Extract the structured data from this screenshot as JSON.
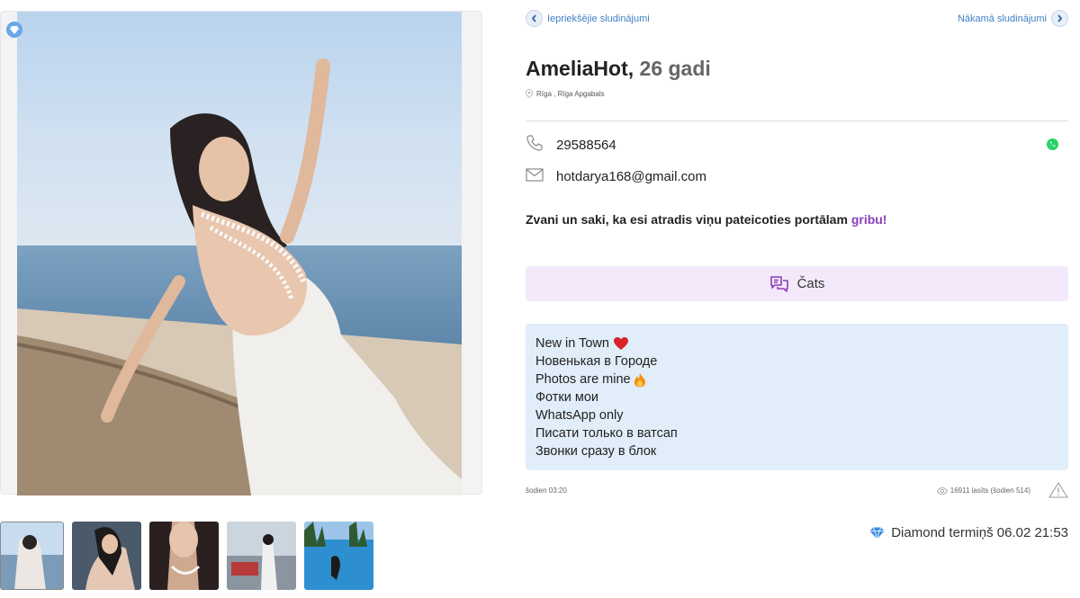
{
  "navigation": {
    "prev_label": "Iepriekšējie sludinājumi",
    "next_label": "Nākamā sludinājumi"
  },
  "listing": {
    "name": "AmeliaHot,",
    "age": "26 gadi",
    "location": "Rīga , Rīga Apgabals",
    "phone": "29588564",
    "email": "hotdarya168@gmail.com",
    "callout_text": "Zvani un saki, ka esi atradis viņu pateicoties portālam",
    "callout_brand": "gribu!",
    "chat_label": "Čats",
    "description_lines": [
      "New in Town",
      "Новенькая в Городе",
      "Photos are mine",
      "Фотки мои",
      "WhatsApp only",
      "Писати только в ватсап",
      "Звонки сразу в блок"
    ],
    "posted": "šodien 03:20",
    "views": "16911 lasīts (šodien 514)",
    "diamond_term": "Diamond termiņš 06.02 21:53"
  },
  "icons": {
    "nav_prev": "chevron-left-icon",
    "nav_next": "chevron-right-icon",
    "badge": "diamond-icon",
    "location": "location-pin-icon",
    "phone": "phone-icon",
    "whatsapp": "whatsapp-icon",
    "email": "envelope-icon",
    "chat": "chat-icon",
    "views": "eye-icon",
    "report": "warning-icon",
    "diamond": "diamond-icon",
    "heart_emoji": "heart-emoji",
    "fire_emoji": "fire-emoji"
  },
  "colors": {
    "link": "#3f7fc4",
    "brand": "#8a3fb8",
    "chat_bg": "#f3e9fb",
    "description_bg": "#e1edf9",
    "whatsapp": "#25d366",
    "diamond": "#3f8ee0"
  },
  "thumbnails_count": 5
}
